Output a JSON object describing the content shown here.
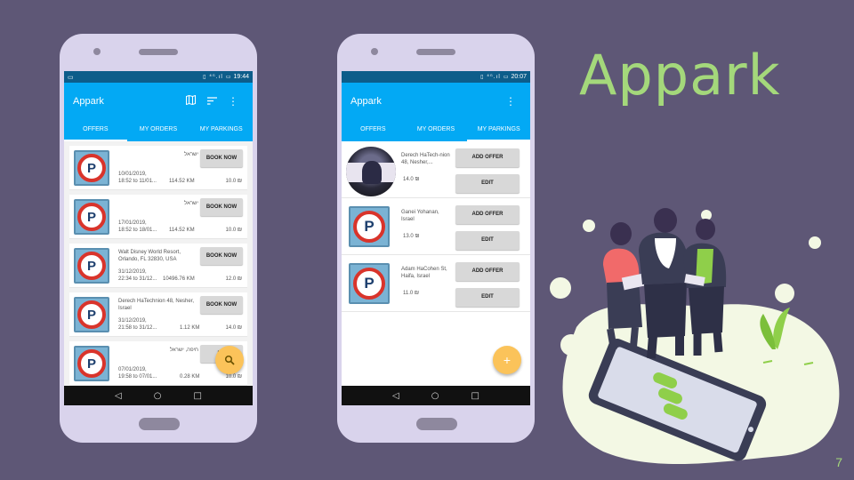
{
  "brand": {
    "title": "Appark",
    "color": "#a4d87b"
  },
  "page_number": "7",
  "phone1": {
    "statusbar": {
      "left_icon": "screen-icon",
      "icons": "▯ ⁴ᴳ.ıl ▭",
      "time": "19:44"
    },
    "appbar": {
      "title": "Appark",
      "icons": [
        "map-icon",
        "sort-icon",
        "more-vert-icon"
      ]
    },
    "tabs": [
      {
        "label": "OFFERS",
        "active": true
      },
      {
        "label": "MY ORDERS",
        "active": false
      },
      {
        "label": "MY PARKINGS",
        "active": false
      }
    ],
    "offers": [
      {
        "address": "ישראל",
        "rtl": true,
        "dates": [
          "10/01/2019,",
          "18:52  to 11/01..."
        ],
        "km": "114.52 KM",
        "price": "10.0 ₪",
        "button": "BOOK NOW"
      },
      {
        "address": "ישראל",
        "rtl": true,
        "dates": [
          "17/01/2019,",
          "18:52  to 18/01..."
        ],
        "km": "114.52 KM",
        "price": "10.0 ₪",
        "button": "BOOK NOW"
      },
      {
        "address": "Walt Disney World Resort, Orlando, FL 32830, USA",
        "rtl": false,
        "dates": [
          "31/12/2019,",
          "22:34  to 31/12..."
        ],
        "km": "10496.76 KM",
        "price": "12.0 ₪",
        "button": "BOOK NOW"
      },
      {
        "address": "Derech HaTechnion 48, Nesher, Israel",
        "rtl": false,
        "dates": [
          "31/12/2019,",
          "21:58  to 31/12..."
        ],
        "km": "1.12 KM",
        "price": "14.0 ₪",
        "button": "BOOK NOW"
      },
      {
        "address": "חיפה, ישראל",
        "rtl": true,
        "dates": [
          "07/01/2019,",
          "19:58  to 07/01..."
        ],
        "km": "0.28 KM",
        "price": "10.0 ₪",
        "button": "BO"
      }
    ],
    "fab_icon": "search-icon"
  },
  "phone2": {
    "statusbar": {
      "icons": "▯ ⁴ᴳ.ıl ▭",
      "time": "20:07"
    },
    "appbar": {
      "title": "Appark",
      "icons": [
        "more-vert-icon"
      ]
    },
    "tabs": [
      {
        "label": "OFFERS",
        "active": false
      },
      {
        "label": "MY ORDERS",
        "active": false
      },
      {
        "label": "MY PARKINGS",
        "active": true
      }
    ],
    "parkings": [
      {
        "image": "user-photo",
        "address": "Derech HaTech-nion 48, Nesher,...",
        "price": "14.0 ₪",
        "add_offer": "ADD OFFER",
        "edit": "EDIT"
      },
      {
        "image": "parking-sign",
        "address": "Ganei Yohanan, Israel",
        "price": "13.0 ₪",
        "add_offer": "ADD OFFER",
        "edit": "EDIT"
      },
      {
        "image": "parking-sign",
        "address": "Adam HaCohen St, Haifa, Israel",
        "price": "11.0 ₪",
        "add_offer": "ADD OFFER",
        "edit": "EDIT"
      }
    ],
    "fab_label": "+"
  },
  "navbar": {
    "back": "◁",
    "home": "○",
    "recents": "□"
  },
  "parking_letter": "P"
}
